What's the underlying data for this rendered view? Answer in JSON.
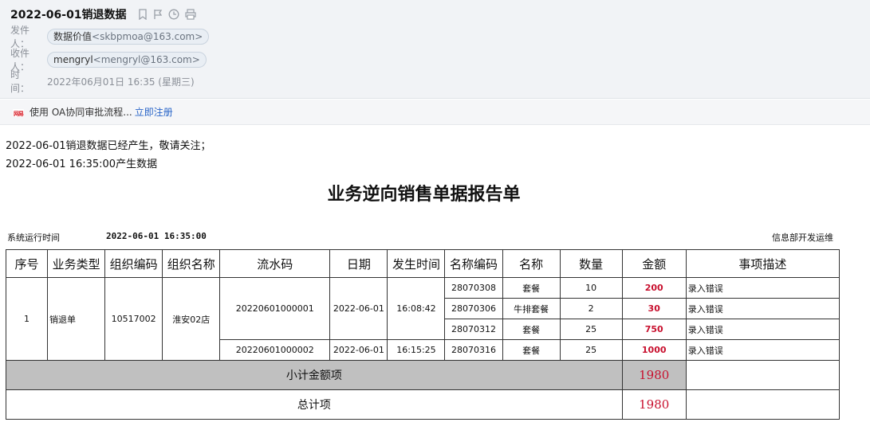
{
  "mail": {
    "subject": "2022-06-01销退数据",
    "from_label": "发件人：",
    "from_name": "数据价值",
    "from_addr": "<skbpmoa@163.com>",
    "to_label": "收件人：",
    "to_name": "mengryl",
    "to_addr": "<mengryl@163.com>",
    "time_label": "时　间：",
    "time_value": "2022年06月01日 16:35 (星期三)"
  },
  "notice": {
    "text": "使用 OA协同审批流程...",
    "link": "立即注册"
  },
  "body": {
    "line1": "2022-06-01销退数据已经产生，敬请关注；",
    "line2": "2022-06-01 16:35:00产生数据"
  },
  "report": {
    "title": "业务逆向销售单据报告单",
    "sys_label": "系统运行时间",
    "sys_time": "2022-06-01 16:35:00",
    "dept": "信息部开发运维",
    "headers": [
      "序号",
      "业务类型",
      "组织编码",
      "组织名称",
      "流水码",
      "日期",
      "发生时间",
      "名称编码",
      "名称",
      "数量",
      "金额",
      "事项描述"
    ],
    "group": {
      "seq": "1",
      "type": "销退单",
      "org_code": "10517002",
      "org_name": "淮安02店"
    },
    "batches": [
      {
        "serial": "20220601000001",
        "date": "2022-06-01",
        "time": "16:08:42",
        "items": [
          {
            "code": "28070308",
            "name": "套餐",
            "qty": "10",
            "amount": "200",
            "desc": "录入错误"
          },
          {
            "code": "28070306",
            "name": "牛排套餐",
            "qty": "2",
            "amount": "30",
            "desc": "录入错误"
          },
          {
            "code": "28070312",
            "name": "套餐",
            "qty": "25",
            "amount": "750",
            "desc": "录入错误"
          }
        ]
      },
      {
        "serial": "20220601000002",
        "date": "2022-06-01",
        "time": "16:15:25",
        "items": [
          {
            "code": "28070316",
            "name": "套餐",
            "qty": "25",
            "amount": "1000",
            "desc": "录入错误"
          }
        ]
      }
    ],
    "subtotal_label": "小计金额项",
    "subtotal_value": "1980",
    "total_label": "总计项",
    "total_value": "1980"
  },
  "colors": {
    "header_bg": "#f1f3f6",
    "amount_red": "#c8102e",
    "subtotal_bg": "#c0c0c0",
    "link_blue": "#2a66c8"
  },
  "icons": [
    "bookmark-icon",
    "flag-icon",
    "clock-icon",
    "print-icon",
    "mail-logo-icon"
  ]
}
